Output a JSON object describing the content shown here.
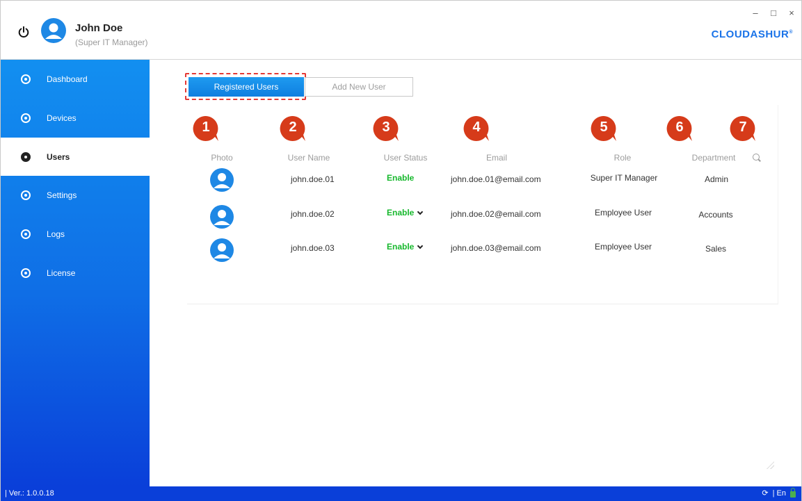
{
  "header": {
    "user_name": "John Doe",
    "user_role": "(Super IT Manager)",
    "brand": "CLOUDASHUR",
    "brand_mark": "®",
    "window_controls": [
      "–",
      "□",
      "×"
    ]
  },
  "sidebar": {
    "items": [
      {
        "label": "Dashboard",
        "icon": "dashboard-icon",
        "active": false
      },
      {
        "label": "Devices",
        "icon": "usb-icon",
        "active": false
      },
      {
        "label": "Users",
        "icon": "user-icon",
        "active": true
      },
      {
        "label": "Settings",
        "icon": "gear-icon",
        "active": false
      },
      {
        "label": "Logs",
        "icon": "list-icon",
        "active": false
      },
      {
        "label": "License",
        "icon": "key-icon",
        "active": false
      }
    ]
  },
  "tabs": {
    "registered": "Registered Users",
    "add_new": "Add New User"
  },
  "badges": [
    "1",
    "2",
    "3",
    "4",
    "5",
    "6",
    "7"
  ],
  "table": {
    "headers": {
      "photo": "Photo",
      "user_name": "User Name",
      "user_status": "User Status",
      "email": "Email",
      "role": "Role",
      "department": "Department"
    },
    "rows": [
      {
        "user_name": "john.doe.01",
        "status": "Enable",
        "email": "john.doe.01@email.com",
        "role": "Super IT Manager",
        "department": "Admin"
      },
      {
        "user_name": "john.doe.02",
        "status": "Enable",
        "email": "john.doe.02@email.com",
        "role": "Employee User",
        "department": "Accounts"
      },
      {
        "user_name": "john.doe.03",
        "status": "Enable",
        "email": "john.doe.03@email.com",
        "role": "Employee User",
        "department": "Sales"
      }
    ]
  },
  "statusbar": {
    "version": "| Ver.: 1.0.0.18",
    "language": "| En"
  },
  "colors": {
    "accent": "#0f7fe0",
    "badge": "#d63b1a",
    "enable": "#16b82c",
    "dashed_outline": "#e53935"
  }
}
